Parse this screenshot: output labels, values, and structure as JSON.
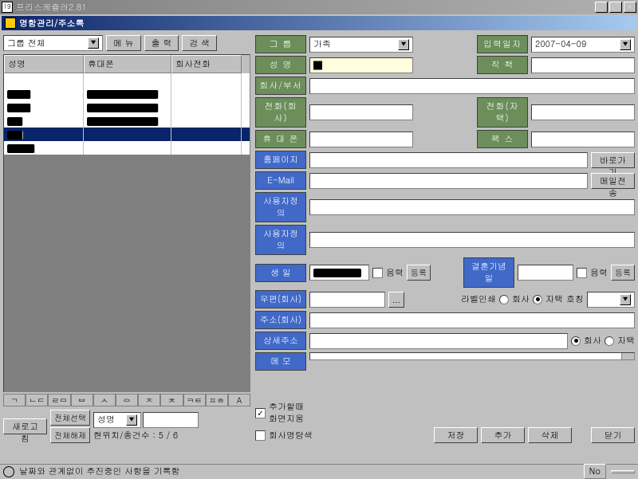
{
  "outer_title": "프리스케쥴러2.81",
  "inner_title": "명함관리/주소록",
  "outer_icon": "19",
  "left": {
    "group_dropdown": "그룹 전체",
    "btn_menu": "메 뉴",
    "btn_print": "출 력",
    "btn_search": "검 색",
    "headers": {
      "name": "성명",
      "mobile": "휴대폰",
      "comptel": "회사전화"
    },
    "index": [
      "ㄱ",
      "ㄴㄷ",
      "ㄹㅁ",
      "ㅂ",
      "ㅅ",
      "ㅇ",
      "ㅈ",
      "ㅊ",
      "ㅋㅌ",
      "ㅍㅎ",
      "A"
    ],
    "btn_refresh": "새로고침",
    "btn_selectall": "전체선택",
    "btn_deselect": "전체해제",
    "search_field_label": "성명",
    "counter_label": "현위치/총건수 :",
    "counter_value": "5 / 6",
    "chk_company_search": "회사명탐색"
  },
  "form": {
    "lbl_group": "그    룹",
    "val_group": "가족",
    "lbl_inputdate": "입력일자",
    "val_inputdate": "2007-04-09",
    "lbl_name": "성    명",
    "val_name": "█",
    "lbl_title": "직    책",
    "lbl_company": "회사/부서",
    "lbl_tel_company": "전화(회사)",
    "lbl_tel_home": "전화(자택)",
    "lbl_mobile": "휴 대 폰",
    "lbl_fax": "팩    스",
    "lbl_homepage": "홈페이지",
    "btn_go": "바로가기",
    "lbl_email": "E-Mail",
    "btn_sendmail": "메일전송",
    "lbl_custom1": "사용자정의",
    "lbl_custom2": "사용자정의",
    "lbl_birthday": "생    일",
    "chk_lunar": "음력",
    "btn_reg": "등록",
    "lbl_anniversary": "결혼기념일",
    "chk_lunar2": "음력",
    "lbl_zip": "우편(회사)",
    "lbl_labelprint": "라벨인쇄",
    "radio_company": "회사",
    "radio_home": "자택",
    "lbl_honorific": "호칭",
    "lbl_addr": "주소(회사)",
    "lbl_addr_detail": "상세주소",
    "lbl_memo": "메    모",
    "chk_clear_on_add": "추가할때",
    "chk_clear_on_add2": "화면지움"
  },
  "buttons": {
    "save": "저장",
    "add": "추가",
    "delete": "삭제",
    "close": "닫기"
  },
  "status": {
    "text": "날짜와 관계없이 추진중인 사항을 기록함",
    "no": "No"
  }
}
